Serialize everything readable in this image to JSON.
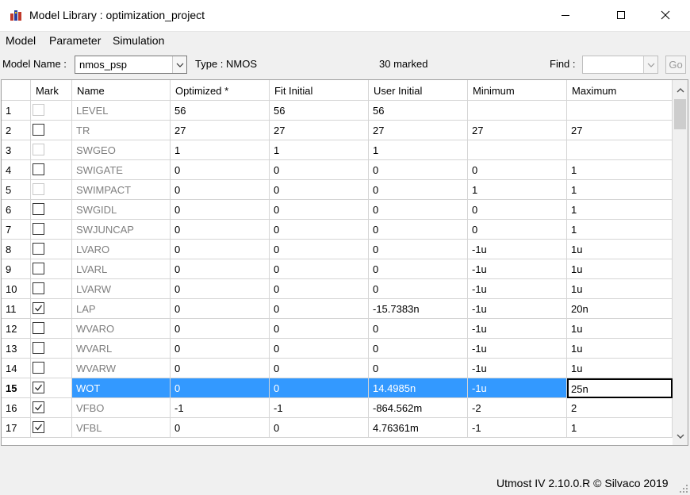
{
  "window": {
    "title": "Model Library : optimization_project",
    "icon": "model-library-icon",
    "controls": [
      "minimize-icon",
      "maximize-icon",
      "close-icon"
    ]
  },
  "menu": [
    "Model",
    "Parameter",
    "Simulation"
  ],
  "toolbar": {
    "model_name_label": "Model Name :",
    "model_name_value": "nmos_psp",
    "type_label": "Type : NMOS",
    "marked_count": "30 marked",
    "find_label": "Find :",
    "find_value": "",
    "go_label": "Go"
  },
  "table": {
    "columns": [
      "",
      "Mark",
      "Name",
      "Optimized *",
      "Fit Initial",
      "User Initial",
      "Minimum",
      "Maximum"
    ],
    "selected_row": 15,
    "editing_column": "Maximum",
    "rows": [
      {
        "n": "1",
        "mark": "disabled",
        "name": "LEVEL",
        "opt": "56",
        "fit": "56",
        "user": "56",
        "min": "",
        "max": ""
      },
      {
        "n": "2",
        "mark": "unchecked",
        "name": "TR",
        "opt": "27",
        "fit": "27",
        "user": "27",
        "min": "27",
        "max": "27"
      },
      {
        "n": "3",
        "mark": "disabled",
        "name": "SWGEO",
        "opt": "1",
        "fit": "1",
        "user": "1",
        "min": "",
        "max": ""
      },
      {
        "n": "4",
        "mark": "unchecked",
        "name": "SWIGATE",
        "opt": "0",
        "fit": "0",
        "user": "0",
        "min": "0",
        "max": "1"
      },
      {
        "n": "5",
        "mark": "disabled",
        "name": "SWIMPACT",
        "opt": "0",
        "fit": "0",
        "user": "0",
        "min": "1",
        "max": "1"
      },
      {
        "n": "6",
        "mark": "unchecked",
        "name": "SWGIDL",
        "opt": "0",
        "fit": "0",
        "user": "0",
        "min": "0",
        "max": "1"
      },
      {
        "n": "7",
        "mark": "unchecked",
        "name": "SWJUNCAP",
        "opt": "0",
        "fit": "0",
        "user": "0",
        "min": "0",
        "max": "1"
      },
      {
        "n": "8",
        "mark": "unchecked",
        "name": "LVARO",
        "opt": "0",
        "fit": "0",
        "user": "0",
        "min": "-1u",
        "max": "1u"
      },
      {
        "n": "9",
        "mark": "unchecked",
        "name": "LVARL",
        "opt": "0",
        "fit": "0",
        "user": "0",
        "min": "-1u",
        "max": "1u"
      },
      {
        "n": "10",
        "mark": "unchecked",
        "name": "LVARW",
        "opt": "0",
        "fit": "0",
        "user": "0",
        "min": "-1u",
        "max": "1u"
      },
      {
        "n": "11",
        "mark": "checked",
        "name": "LAP",
        "opt": "0",
        "fit": "0",
        "user": "-15.7383n",
        "min": "-1u",
        "max": "20n"
      },
      {
        "n": "12",
        "mark": "unchecked",
        "name": "WVARO",
        "opt": "0",
        "fit": "0",
        "user": "0",
        "min": "-1u",
        "max": "1u"
      },
      {
        "n": "13",
        "mark": "unchecked",
        "name": "WVARL",
        "opt": "0",
        "fit": "0",
        "user": "0",
        "min": "-1u",
        "max": "1u"
      },
      {
        "n": "14",
        "mark": "unchecked",
        "name": "WVARW",
        "opt": "0",
        "fit": "0",
        "user": "0",
        "min": "-1u",
        "max": "1u"
      },
      {
        "n": "15",
        "mark": "checked",
        "name": "WOT",
        "opt": "0",
        "fit": "0",
        "user": "14.4985n",
        "min": "-1u",
        "max": "25n"
      },
      {
        "n": "16",
        "mark": "checked",
        "name": "VFBO",
        "opt": "-1",
        "fit": "-1",
        "user": "-864.562m",
        "min": "-2",
        "max": "2"
      },
      {
        "n": "17",
        "mark": "checked",
        "name": "VFBL",
        "opt": "0",
        "fit": "0",
        "user": "4.76361m",
        "min": "-1",
        "max": "1"
      }
    ]
  },
  "status": {
    "text": "Utmost IV 2.10.0.R © Silvaco 2019"
  },
  "colors": {
    "selection": "#3399ff",
    "grid_line": "#d5d5d5",
    "window_bg": "#f0f0f0"
  }
}
